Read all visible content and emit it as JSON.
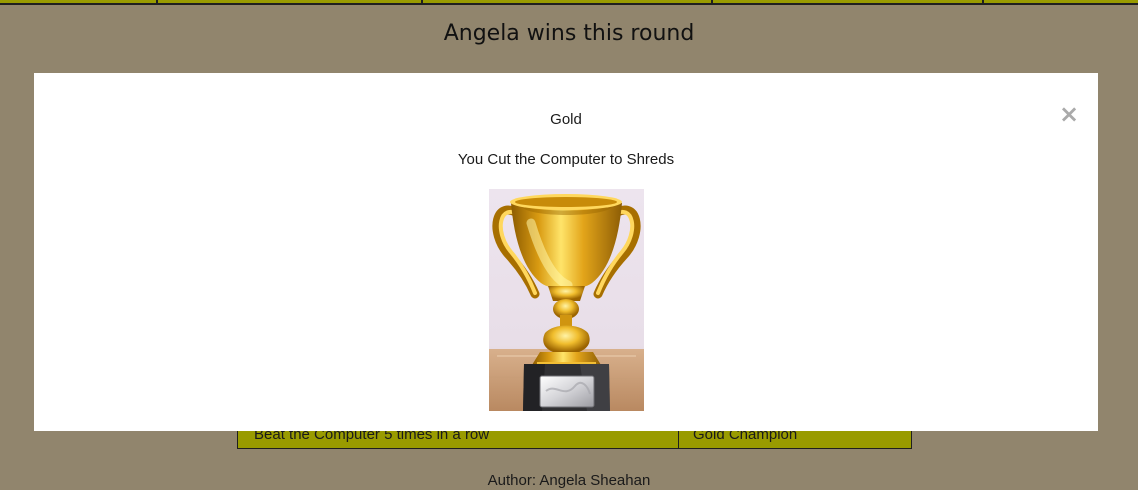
{
  "game": {
    "round_result": "Angela wins this round"
  },
  "modal": {
    "medal_title": "Gold",
    "medal_message": "You Cut the Computer to Shreds",
    "close_symbol": "×",
    "image_icon": "gold-trophy-icon"
  },
  "achievements": {
    "visible_row": {
      "condition": "Beat the Computer 5 times in a row",
      "award": "Gold Champion"
    }
  },
  "footer": {
    "author": "Author: Angela Sheahan"
  },
  "colors": {
    "page_background": "#91856d",
    "table_background": "#999b00",
    "modal_background": "#ffffff",
    "close_color": "#aaaaaa"
  }
}
